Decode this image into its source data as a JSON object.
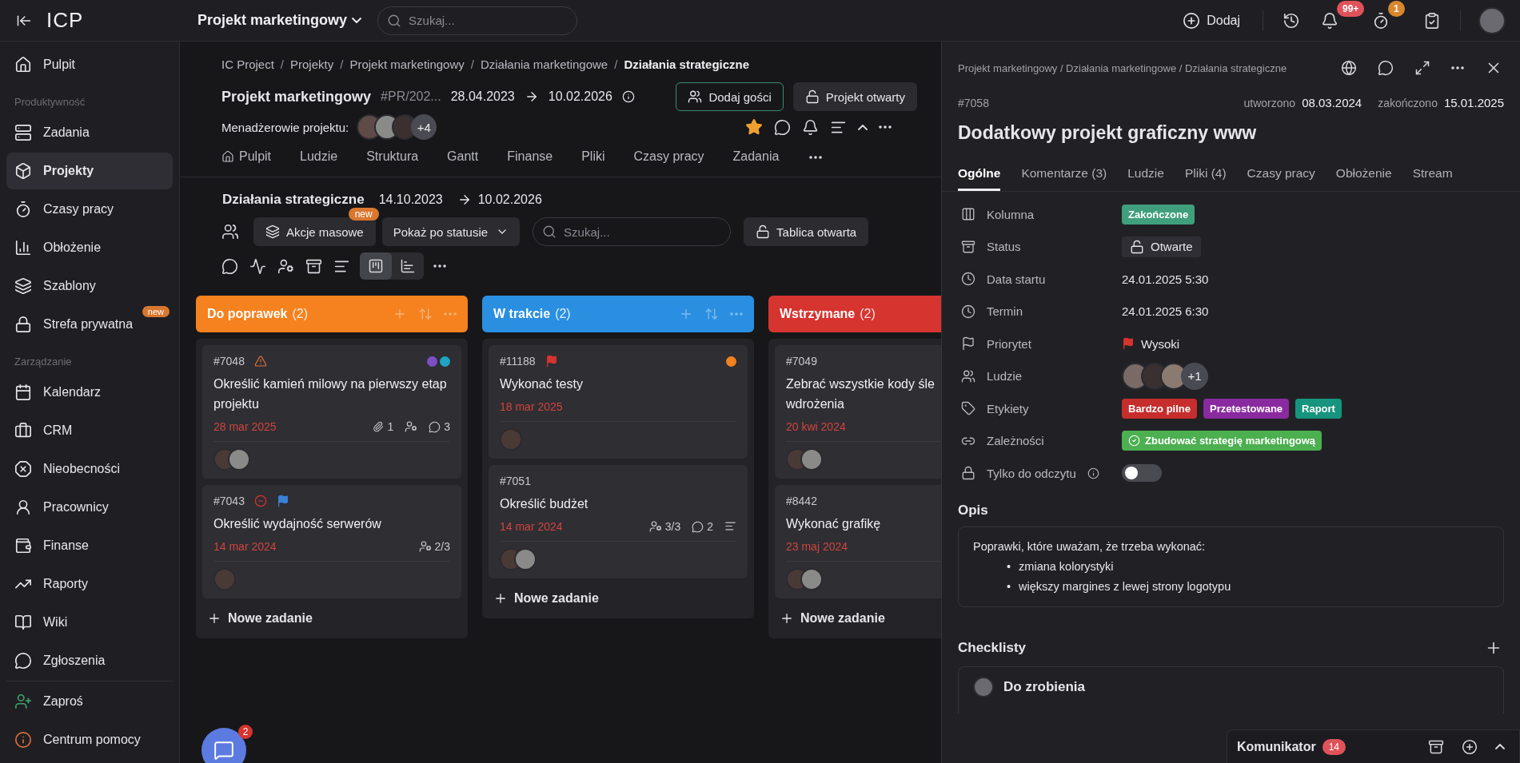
{
  "topbar": {
    "logo": "ICP",
    "project_selector": "Projekt marketingowy",
    "search": {
      "placeholder": "Szukaj..."
    },
    "add_button": "Dodaj",
    "notifications_badge": "99+",
    "timer_badge": "1"
  },
  "sidebar": {
    "groups": [
      {
        "items": [
          {
            "label": "Pulpit",
            "selected": false
          }
        ]
      },
      {
        "heading": "Produktywność",
        "items": [
          {
            "label": "Zadania",
            "selected": false
          },
          {
            "label": "Projekty",
            "selected": true
          },
          {
            "label": "Czasy pracy",
            "selected": false
          },
          {
            "label": "Obłożenie",
            "selected": false
          },
          {
            "label": "Szablony",
            "selected": false
          },
          {
            "label": "Strefa prywatna",
            "selected": false,
            "badge": "new"
          }
        ]
      },
      {
        "heading": "Zarządzanie",
        "items": [
          {
            "label": "Kalendarz",
            "selected": false
          },
          {
            "label": "CRM",
            "selected": false
          },
          {
            "label": "Nieobecności",
            "selected": false
          },
          {
            "label": "Pracownicy",
            "selected": false
          },
          {
            "label": "Finanse",
            "selected": false
          },
          {
            "label": "Raporty",
            "selected": false
          },
          {
            "label": "Wiki",
            "selected": false
          },
          {
            "label": "Zgłoszenia",
            "selected": false
          }
        ]
      },
      {
        "items": [
          {
            "label": "Zaproś",
            "selected": false,
            "color": "#3fa46a"
          },
          {
            "label": "Centrum pomocy",
            "selected": false,
            "color": "#e0703a"
          }
        ]
      }
    ]
  },
  "project": {
    "breadcrumb_separator": "/",
    "breadcrumb": [
      "IC Project",
      "Projekty",
      "Projekt marketingowy",
      "Działania marketingowe",
      "Działania strategiczne"
    ],
    "title": "Projekt marketingowy",
    "code": "#PR/202...",
    "start": "28.04.2023",
    "end": "10.02.2026",
    "managers_label": "Menadżerowie projektu:",
    "managers": [
      {
        "kind": "photo"
      },
      {
        "kind": "photo"
      },
      {
        "kind": "photo"
      }
    ],
    "managers_more": "+4",
    "guests_button": "Dodaj gości",
    "status_button": "Projekt otwarty",
    "favorite": true,
    "tabs": [
      {
        "label": "Pulpit",
        "selected": false
      },
      {
        "label": "Ludzie",
        "selected": false
      },
      {
        "label": "Struktura",
        "selected": false
      },
      {
        "label": "Gantt",
        "selected": false
      },
      {
        "label": "Finanse",
        "selected": false
      },
      {
        "label": "Pliki",
        "selected": false
      },
      {
        "label": "Czasy pracy",
        "selected": false
      },
      {
        "label": "Zadania",
        "selected": false
      }
    ]
  },
  "board": {
    "title": "Działania strategiczne",
    "start": "14.10.2023",
    "end": "10.02.2026",
    "bulk_button": "Akcje masowe",
    "bulk_badge": "new",
    "group_select": "Pokaż po statusie",
    "search": {
      "placeholder": "Szukaj..."
    },
    "board_status": "Tablica otwarta",
    "views": [
      {
        "selected": true
      },
      {
        "selected": false
      }
    ],
    "columns": [
      {
        "title": "Do poprawek",
        "count": "(2)",
        "color": "#f5821f",
        "new_task": "Nowe zadanie",
        "cards": [
          {
            "id": "#7048",
            "markers": [
              {
                "kind": "warning"
              }
            ],
            "dots": [
              {
                "color": "#7d4fc4"
              },
              {
                "color": "#1fa3c4"
              }
            ],
            "title_lines": [
              "Określić kamień milowy na pierwszy etap projektu"
            ],
            "date": "28 mar 2025",
            "meta": [
              {
                "kind": "attachments",
                "text": "1"
              },
              {
                "kind": "assignee"
              },
              {
                "kind": "comments",
                "text": "3"
              }
            ],
            "assignees": [
              {
                "kind": "photo"
              },
              {
                "kind": "photo"
              }
            ]
          },
          {
            "id": "#7043",
            "markers": [
              {
                "kind": "blocked"
              },
              {
                "kind": "flag",
                "color": "#3b82d6"
              }
            ],
            "title_lines": [
              "Określić wydajność serwerów"
            ],
            "date": "14 mar 2024",
            "meta": [
              {
                "kind": "assignee",
                "text": "2/3"
              }
            ],
            "assignees": [
              {
                "kind": "photo"
              }
            ]
          }
        ]
      },
      {
        "title": "W trakcie",
        "count": "(2)",
        "color": "#2a8fe0",
        "new_task": "Nowe zadanie",
        "cards": [
          {
            "id": "#11188",
            "markers": [
              {
                "kind": "flag",
                "color": "#d6342f"
              }
            ],
            "dots": [
              {
                "color": "#f0821f"
              }
            ],
            "title_lines": [
              "Wykonać testy"
            ],
            "date": "18 mar 2025",
            "assignees": [
              {
                "kind": "photo"
              }
            ]
          },
          {
            "id": "#7051",
            "title_lines": [
              "Określić budżet"
            ],
            "date": "14 mar 2024",
            "meta": [
              {
                "kind": "assignee",
                "text": "3/3"
              },
              {
                "kind": "comments",
                "text": "2"
              },
              {
                "kind": "description"
              }
            ],
            "assignees": [
              {
                "kind": "photo"
              },
              {
                "kind": "photo"
              }
            ]
          }
        ]
      },
      {
        "title": "Wstrzymane",
        "count": "(2)",
        "color": "#d6342f",
        "new_task": "Nowe zadanie",
        "cards": [
          {
            "id": "#7049",
            "title_lines": [
              "Zebrać wszystkie kody śle",
              "wdrożenia"
            ],
            "date": "20 kwi 2024",
            "assignees": [
              {
                "kind": "photo"
              },
              {
                "kind": "photo"
              }
            ]
          },
          {
            "id": "#8442",
            "title_lines": [
              "Wykonać grafikę"
            ],
            "date": "23 maj 2024",
            "assignees": [
              {
                "kind": "photo"
              },
              {
                "kind": "photo"
              }
            ]
          }
        ]
      }
    ]
  },
  "chat_bubble": {
    "badge": "2"
  },
  "task": {
    "breadcrumb": "Projekt marketingowy / Działania marketingowe / Działania strategiczne",
    "id": "#7058",
    "created_label": "utworzono",
    "created": "08.03.2024",
    "finished_label": "zakończono",
    "finished": "15.01.2025",
    "title": "Dodatkowy projekt graficzny www",
    "tabs": [
      {
        "label": "Ogólne",
        "selected": true
      },
      {
        "label": "Komentarze (3)",
        "selected": false
      },
      {
        "label": "Ludzie",
        "selected": false
      },
      {
        "label": "Pliki (4)",
        "selected": false
      },
      {
        "label": "Czasy pracy",
        "selected": false
      },
      {
        "label": "Obłożenie",
        "selected": false
      },
      {
        "label": "Stream",
        "selected": false
      }
    ],
    "fields": [
      {
        "kind": "column",
        "label": "Kolumna",
        "tags": [
          {
            "text": "Zakończone",
            "color": "#3f9f7c"
          }
        ]
      },
      {
        "kind": "status",
        "label": "Status",
        "value": "Otwarte"
      },
      {
        "kind": "date",
        "label": "Data startu",
        "value": "24.01.2025 5:30"
      },
      {
        "kind": "date",
        "label": "Termin",
        "value": "24.01.2025 6:30"
      },
      {
        "kind": "priority",
        "label": "Priorytet",
        "value": "Wysoki",
        "color": "#d6342f"
      },
      {
        "kind": "people",
        "label": "Ludzie",
        "people": [
          {
            "kind": "photo"
          },
          {
            "kind": "photo"
          },
          {
            "kind": "photo"
          }
        ],
        "more": "+1"
      },
      {
        "kind": "labels",
        "label": "Etykiety",
        "tags": [
          {
            "text": "Bardzo pilne",
            "color": "#c62d2d"
          },
          {
            "text": "Przetestowane",
            "color": "#8a2aa0"
          },
          {
            "text": "Raport",
            "color": "#16947e"
          }
        ]
      },
      {
        "kind": "dependency",
        "label": "Zależności",
        "value": "Zbudować strategię marketingową",
        "color": "#4caf50"
      },
      {
        "kind": "toggle",
        "label": "Tylko do odczytu",
        "on": false
      }
    ],
    "description_heading": "Opis",
    "description": {
      "bullet_marker": "•",
      "intro": "Poprawki, które uważam, że trzeba wykonać:",
      "bullets": [
        "zmiana kolorystyki",
        "większy margines z lewej strony logotypu"
      ]
    },
    "checklists_heading": "Checklisty",
    "checklists": [
      {
        "title": "Do zrobienia"
      }
    ]
  },
  "messenger": {
    "title": "Komunikator",
    "badge": "14"
  }
}
